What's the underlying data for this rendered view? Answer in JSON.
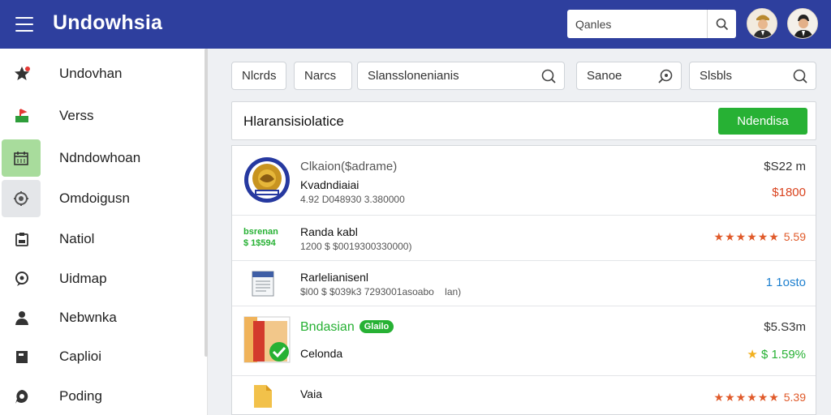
{
  "header": {
    "title": "Undowhsia",
    "search_placeholder": "Qanles",
    "avatars": [
      "user-avatar-1",
      "user-avatar-2"
    ]
  },
  "sidebar": {
    "items": [
      {
        "label": "Undovhan",
        "icon": "star-icon"
      },
      {
        "label": "Verss",
        "icon": "flag-icon"
      },
      {
        "label": "Ndndowhoan",
        "icon": "calendar-icon"
      },
      {
        "label": "Omdoigusn",
        "icon": "settings-icon"
      },
      {
        "label": "Natiol",
        "icon": "clipboard-icon"
      },
      {
        "label": "Uidmap",
        "icon": "location-icon"
      },
      {
        "label": "Nebwnka",
        "icon": "person-icon"
      },
      {
        "label": "Caplioi",
        "icon": "folder-icon"
      },
      {
        "label": "Poding",
        "icon": "chat-icon"
      }
    ]
  },
  "toolbar": {
    "chips": [
      "Nlcrds",
      "Narcs",
      "Slansslonenianis",
      "Sanoe",
      "Slsbls"
    ]
  },
  "panel": {
    "title": "Hlaransisiolatice",
    "action_label": "Ndendisa"
  },
  "rows": [
    {
      "title": "Clkaion($adrame)",
      "title2": "Kvadndiaiai",
      "sub": "4.92 D048930 3.380000",
      "price": "$S22 m",
      "value": "$1800"
    },
    {
      "title": "Randa kabl",
      "sub": "1200 $ $0019300330000)",
      "thumb_text_1": "bsrenan",
      "thumb_text_2": "$ 1$594",
      "rating": "5.59"
    },
    {
      "title": "Rarlelianisenl",
      "sub": "$l00 $ $039k3 7293001asoabo",
      "sub_tail": "lan)",
      "value": "1 1osto"
    },
    {
      "title": "Bndasian",
      "badge": "Glailo",
      "title2": "Celonda",
      "price": "$5.S3m",
      "value": "$ 1.59%"
    },
    {
      "title": "Vaia",
      "rating": "5.39"
    }
  ],
  "colors": {
    "header_bg": "#2e3f9e",
    "accent_green": "#27b134",
    "price_red": "#d9431e",
    "link_blue": "#1c7fcf"
  }
}
